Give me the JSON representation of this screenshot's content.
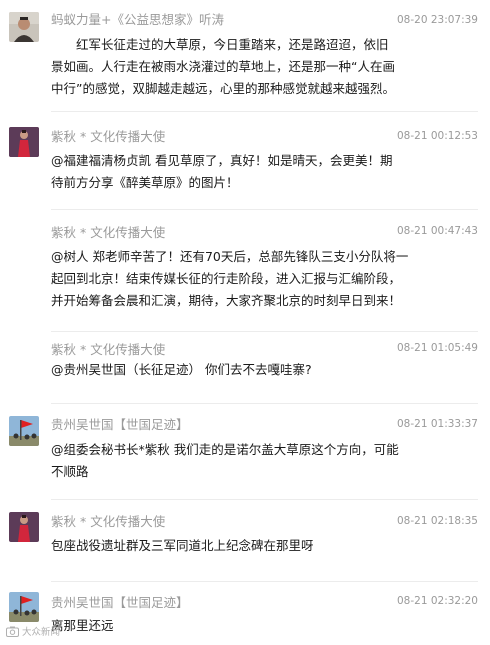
{
  "messages": [
    {
      "name": "蚂蚁力量+《公益思想家》听涛",
      "time": "08-20 23:07:39",
      "avatar": "portrait-photo-avatar",
      "lines": [
        "　　红军长征走过的大草原，今日重踏来，还是路迢迢，依旧",
        "景如画。人行走在被雨水浇灌过的草地上，还是那一种“人在画",
        "中行”的感觉，双脚越走越远，心里的那种感觉就越来越强烈。"
      ]
    },
    {
      "name": "紫秋 * 文化传播大使",
      "time": "08-21 00:12:53",
      "avatar": "woman-red-dress-avatar",
      "lines": [
        "@福建福清杨贞凯 看见草原了，真好！如是晴天，会更美！期",
        "待前方分享《醉美草原》的图片！"
      ]
    },
    {
      "name": "紫秋 * 文化传播大使",
      "time": "08-21 00:47:43",
      "avatar": "",
      "lines": [
        "@树人 郑老师辛苦了！还有70天后，总部先锋队三支小分队将一",
        "起回到北京！结束传媒长征的行走阶段，进入汇报与汇编阶段，",
        "并开始筹备会晨和汇演，期待，大家齐聚北京的时刻早日到来！"
      ]
    },
    {
      "name": "紫秋 * 文化传播大使",
      "time": "08-21 01:05:49",
      "avatar": "",
      "lines": [
        "@贵州吴世国（长征足迹） 你们去不去嘎哇寨?"
      ]
    },
    {
      "name": "贵州吴世国【世国足迹】",
      "time": "08-21 01:33:37",
      "avatar": "red-flag-crowd-avatar",
      "lines": [
        "@组委会秘书长*紫秋 我们走的是诺尔盖大草原这个方向，可能",
        "不顺路"
      ]
    },
    {
      "name": "紫秋 * 文化传播大使",
      "time": "08-21 02:18:35",
      "avatar": "woman-red-dress-avatar",
      "lines": [
        "包座战役遗址群及三军同道北上纪念碑在那里呀"
      ]
    },
    {
      "name": "贵州吴世国【世国足迹】",
      "time": "08-21 02:32:20",
      "avatar": "red-flag-crowd-avatar",
      "lines": [
        "离那里还远"
      ]
    }
  ],
  "watermark": {
    "text": "大众新闻",
    "icon": "camera-icon"
  }
}
